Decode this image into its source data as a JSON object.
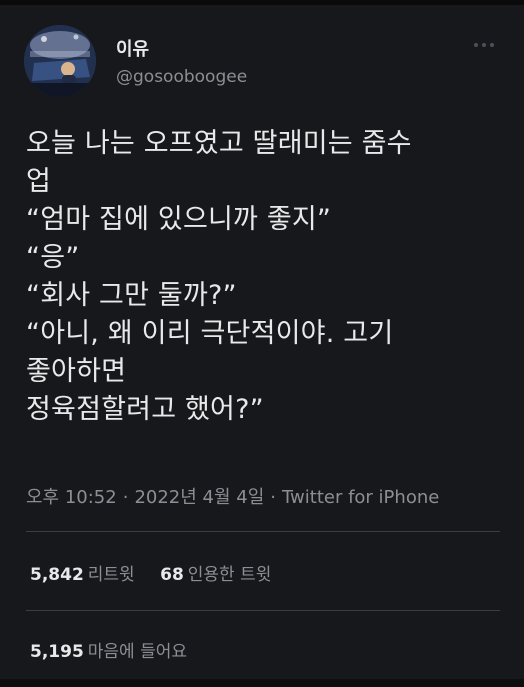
{
  "tweet": {
    "author": {
      "name": "이유",
      "handle": "@gosooboogee"
    },
    "text_lines": [
      "오늘 나는 오프였고 딸래미는 줌수",
      "업",
      "“엄마 집에 있으니까 좋지”",
      "“응”",
      "“회사 그만 둘까?”",
      "“아니, 왜 이리 극단적이야. 고기",
      "좋아하면",
      "정육점할려고 했어?”"
    ],
    "time": "오후 10:52",
    "separator": "·",
    "date": "2022년 4월 4일",
    "source": "Twitter for iPhone",
    "stats": {
      "retweets": {
        "count": "5,842",
        "label": "리트윗"
      },
      "quotes": {
        "count": "68",
        "label": "인용한 트윗"
      },
      "likes": {
        "count": "5,195",
        "label": "마음에 들어요"
      }
    }
  },
  "colors": {
    "background": "#17181b",
    "primary_text": "#e7e9ea",
    "secondary_text": "#8b8f94",
    "divider": "#3b3e42"
  }
}
